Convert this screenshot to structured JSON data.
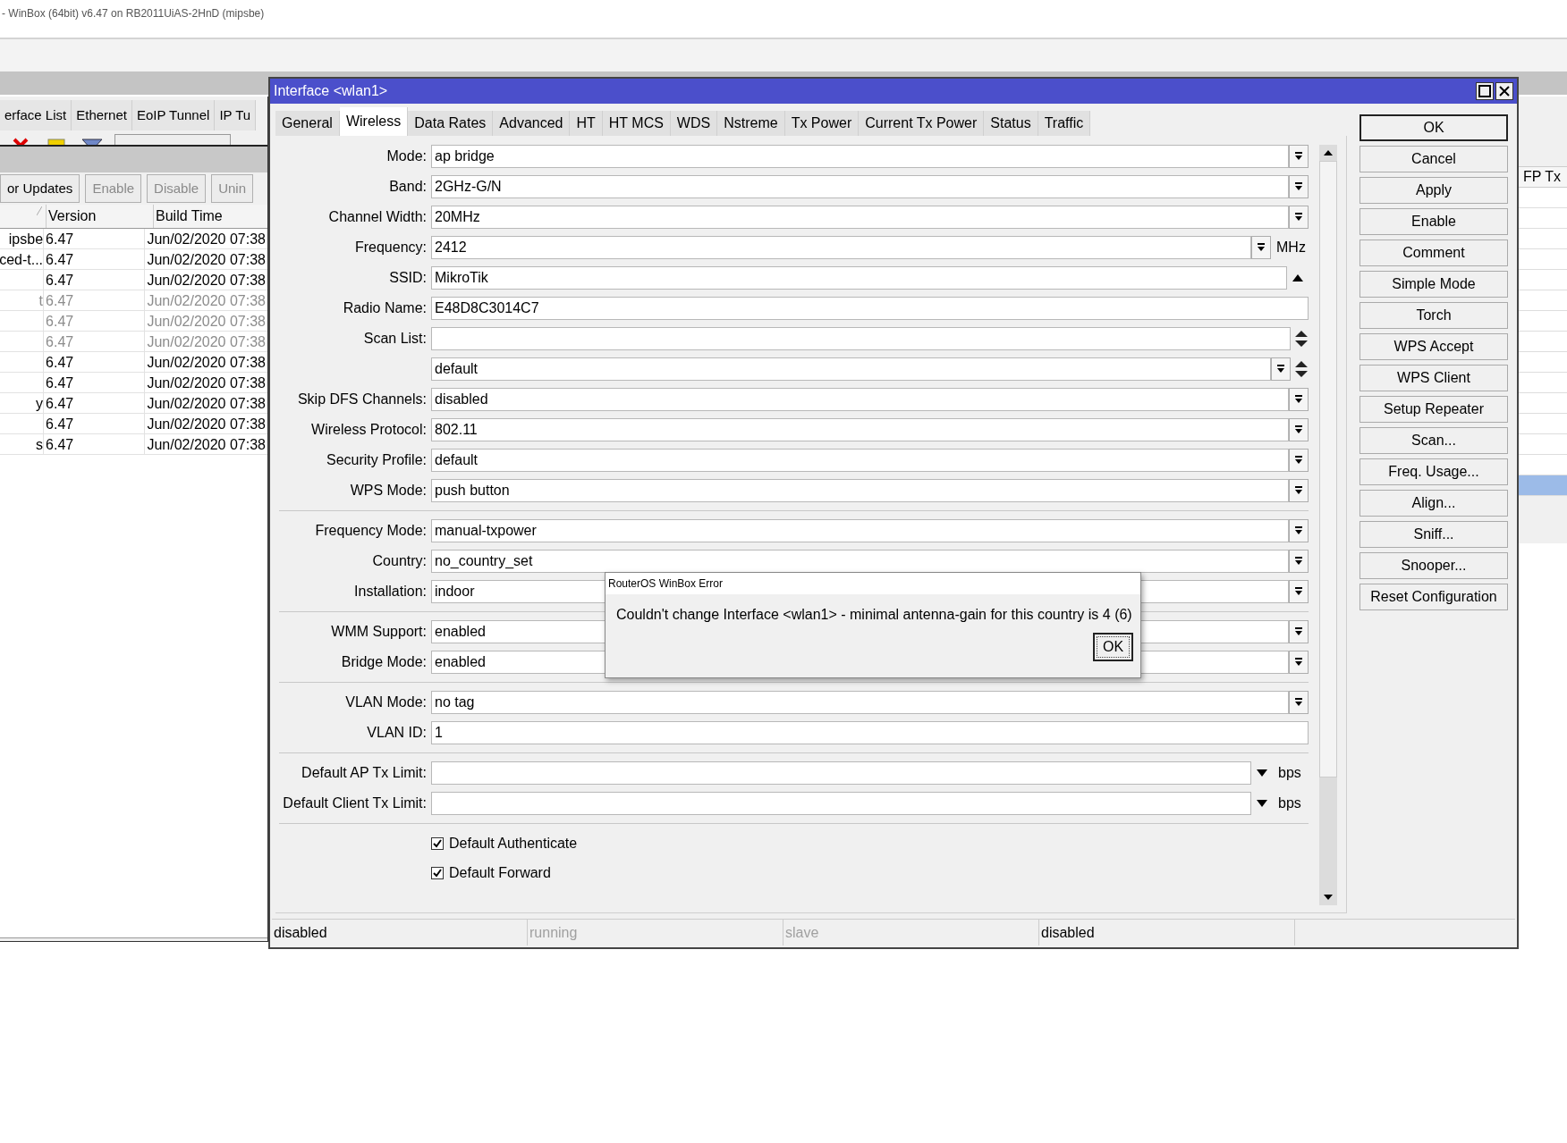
{
  "app_title": "- WinBox (64bit) v6.47 on RB2011UiAS-2HnD (mipsbe)",
  "left_window": {
    "tabs": [
      "erface List",
      "Ethernet",
      "EoIP Tunnel",
      "IP Tu"
    ],
    "packages": {
      "buttons": [
        {
          "label": "or Updates",
          "disabled": false
        },
        {
          "label": "Enable",
          "disabled": true
        },
        {
          "label": "Disable",
          "disabled": true
        },
        {
          "label": "Unin",
          "disabled": true
        }
      ],
      "columns": [
        "Version",
        "Build Time"
      ],
      "rows": [
        {
          "name": "ipsbe",
          "version": "6.47",
          "build": "Jun/02/2020 07:38",
          "disabled": false
        },
        {
          "name": "ced-t...",
          "version": "6.47",
          "build": "Jun/02/2020 07:38",
          "disabled": false
        },
        {
          "version": "6.47",
          "build": "Jun/02/2020 07:38",
          "disabled": false
        },
        {
          "name": "t",
          "version": "6.47",
          "build": "Jun/02/2020 07:38",
          "disabled": true
        },
        {
          "version": "6.47",
          "build": "Jun/02/2020 07:38",
          "disabled": true
        },
        {
          "version": "6.47",
          "build": "Jun/02/2020 07:38",
          "disabled": true
        },
        {
          "version": "6.47",
          "build": "Jun/02/2020 07:38",
          "disabled": false
        },
        {
          "version": "6.47",
          "build": "Jun/02/2020 07:38",
          "disabled": false
        },
        {
          "name": "y",
          "version": "6.47",
          "build": "Jun/02/2020 07:38",
          "disabled": false
        },
        {
          "version": "6.47",
          "build": "Jun/02/2020 07:38",
          "disabled": false
        },
        {
          "name": "s",
          "version": "6.47",
          "build": "Jun/02/2020 07:38",
          "disabled": false
        }
      ]
    }
  },
  "right_window": {
    "column": "FP Tx",
    "rows": [
      {
        "selected": false
      },
      {
        "selected": false
      },
      {
        "selected": false
      },
      {
        "selected": false
      },
      {
        "selected": false
      },
      {
        "selected": false
      },
      {
        "selected": false
      },
      {
        "selected": false
      },
      {
        "selected": false
      },
      {
        "selected": false
      },
      {
        "selected": false
      },
      {
        "selected": false
      },
      {
        "selected": false
      },
      {
        "selected": false
      },
      {
        "selected": true
      }
    ]
  },
  "dialog": {
    "title": "Interface <wlan1>",
    "tabs": [
      {
        "label": "General",
        "selected": false
      },
      {
        "label": "Wireless",
        "selected": true
      },
      {
        "label": "Data Rates",
        "selected": false
      },
      {
        "label": "Advanced",
        "selected": false
      },
      {
        "label": "HT",
        "selected": false
      },
      {
        "label": "HT MCS",
        "selected": false
      },
      {
        "label": "WDS",
        "selected": false
      },
      {
        "label": "Nstreme",
        "selected": false
      },
      {
        "label": "Tx Power",
        "selected": false
      },
      {
        "label": "Current Tx Power",
        "selected": false
      },
      {
        "label": "Status",
        "selected": false
      },
      {
        "label": "Traffic",
        "selected": false
      }
    ],
    "groups": [
      [
        {
          "kind": "dropdown",
          "label": "Mode:",
          "value": "ap bridge"
        },
        {
          "kind": "dropdown",
          "label": "Band:",
          "value": "2GHz-G/N"
        },
        {
          "kind": "dropdown",
          "label": "Channel Width:",
          "value": "20MHz"
        },
        {
          "kind": "dropdown",
          "label": "Frequency:",
          "value": "2412",
          "unit": "MHz"
        },
        {
          "kind": "collapsible",
          "label": "SSID:",
          "value": "MikroTik"
        },
        {
          "kind": "text",
          "label": "Radio Name:",
          "value": "E48D8C3014C7"
        },
        {
          "kind": "list",
          "label": "Scan List:"
        },
        {
          "kind": "listdropdown",
          "value": "default"
        },
        {
          "kind": "dropdown",
          "label": "Skip DFS Channels:",
          "value": "disabled"
        },
        {
          "kind": "dropdown",
          "label": "Wireless Protocol:",
          "value": "802.11"
        },
        {
          "kind": "dropdown",
          "label": "Security Profile:",
          "value": "default"
        },
        {
          "kind": "dropdown",
          "label": "WPS Mode:",
          "value": "push button"
        }
      ],
      [
        {
          "kind": "dropdown",
          "label": "Frequency Mode:",
          "value": "manual-txpower"
        },
        {
          "kind": "dropdown",
          "label": "Country:",
          "value": "no_country_set"
        },
        {
          "kind": "dropdown",
          "label": "Installation:",
          "value": "indoor"
        }
      ],
      [
        {
          "kind": "dropdown",
          "label": "WMM Support:",
          "value": "enabled"
        },
        {
          "kind": "dropdown",
          "label": "Bridge Mode:",
          "value": "enabled"
        }
      ],
      [
        {
          "kind": "dropdown",
          "label": "VLAN Mode:",
          "value": "no tag"
        },
        {
          "kind": "text",
          "label": "VLAN ID:",
          "value": "1"
        }
      ],
      [
        {
          "kind": "limit",
          "label": "Default AP Tx Limit:",
          "unit": "bps"
        },
        {
          "kind": "limit",
          "label": "Default Client Tx Limit:",
          "unit": "bps"
        }
      ],
      [
        {
          "kind": "checkbox",
          "label": "Default Authenticate",
          "checked": true
        },
        {
          "kind": "checkbox",
          "label": "Default Forward",
          "checked": true
        }
      ]
    ],
    "button_groups": [
      [
        {
          "label": "OK",
          "default": true
        },
        {
          "label": "Cancel",
          "default": false
        },
        {
          "label": "Apply",
          "default": false
        }
      ],
      [
        {
          "label": "Enable",
          "default": false
        },
        {
          "label": "Comment",
          "default": false
        }
      ],
      [
        {
          "label": "Simple Mode",
          "default": false
        },
        {
          "label": "Torch",
          "default": false
        },
        {
          "label": "WPS Accept",
          "default": false
        },
        {
          "label": "WPS Client",
          "default": false
        },
        {
          "label": "Setup Repeater",
          "default": false
        }
      ],
      [
        {
          "label": "Scan...",
          "default": false
        },
        {
          "label": "Freq. Usage...",
          "default": false
        },
        {
          "label": "Align...",
          "default": false
        },
        {
          "label": "Sniff...",
          "default": false
        },
        {
          "label": "Snooper...",
          "default": false
        }
      ],
      [
        {
          "label": "Reset Configuration",
          "default": false
        }
      ]
    ],
    "status": [
      {
        "text": "disabled",
        "disabled": false
      },
      {
        "text": "running",
        "disabled": true
      },
      {
        "text": "slave",
        "disabled": true
      },
      {
        "text": "disabled",
        "disabled": false
      }
    ]
  },
  "error": {
    "title": "RouterOS WinBox Error",
    "message": "Couldn't change Interface <wlan1> - minimal antenna-gain for this country is 4 (6)",
    "button": "OK"
  }
}
